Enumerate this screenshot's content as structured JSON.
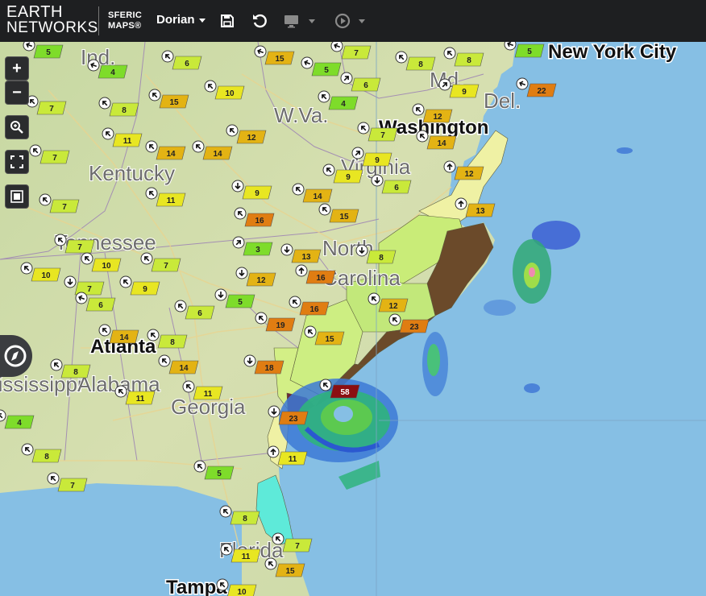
{
  "app": {
    "logo_line1": "EARTH",
    "logo_line2": "NETWORKS",
    "product_line1": "SFERIC",
    "product_line2": "MAPS®",
    "storm_selector": "Dorian"
  },
  "toolbar": {
    "icons": [
      "save-icon",
      "undo-icon",
      "monitor-icon",
      "play-icon"
    ]
  },
  "map_controls": {
    "zoom_in": "+",
    "zoom_out": "−",
    "icons": [
      "zoom-search-icon",
      "fullscreen-icon",
      "layers-icon",
      "compass-icon"
    ]
  },
  "map": {
    "labels": [
      {
        "text": "Ind.",
        "kind": "state"
      },
      {
        "text": "Md.",
        "kind": "state"
      },
      {
        "text": "Del.",
        "kind": "state"
      },
      {
        "text": "W.Va.",
        "kind": "state"
      },
      {
        "text": "Kentucky",
        "kind": "state"
      },
      {
        "text": "Virginia",
        "kind": "state"
      },
      {
        "text": "Tennessee",
        "kind": "state"
      },
      {
        "text": "North",
        "kind": "state"
      },
      {
        "text": "Carolina",
        "kind": "state"
      },
      {
        "text": "Georgia",
        "kind": "state"
      },
      {
        "text": "Mississippi",
        "kind": "state"
      },
      {
        "text": "Alabama",
        "kind": "state"
      },
      {
        "text": "Florida",
        "kind": "state"
      },
      {
        "text": "Washington",
        "kind": "city"
      },
      {
        "text": "Atlanta",
        "kind": "city"
      },
      {
        "text": "New York City",
        "kind": "city"
      },
      {
        "text": "Tampa",
        "kind": "city"
      }
    ],
    "wind_color_scale": {
      "light": "#7edc2a",
      "moderate": "#c9e93a",
      "fresh": "#e8e622",
      "strong": "#e3b314",
      "gale": "#e07d12",
      "hurricane": "#8b0e12"
    },
    "wind_stations": [
      {
        "value": "5",
        "dir": 200
      },
      {
        "value": "4",
        "dir": 200
      },
      {
        "value": "6",
        "dir": 225
      },
      {
        "value": "15",
        "dir": 200
      },
      {
        "value": "7",
        "dir": 200
      },
      {
        "value": "5",
        "dir": 200
      },
      {
        "value": "6",
        "dir": 315
      },
      {
        "value": "8",
        "dir": 225
      },
      {
        "value": "8",
        "dir": 225
      },
      {
        "value": "9",
        "dir": 315
      },
      {
        "value": "5",
        "dir": 200
      },
      {
        "value": "22",
        "dir": 200
      },
      {
        "value": "7",
        "dir": 225
      },
      {
        "value": "8",
        "dir": 225
      },
      {
        "value": "15",
        "dir": 225
      },
      {
        "value": "10",
        "dir": 225
      },
      {
        "value": "4",
        "dir": 225
      },
      {
        "value": "12",
        "dir": 225
      },
      {
        "value": "14",
        "dir": 225
      },
      {
        "value": "11",
        "dir": 225
      },
      {
        "value": "14",
        "dir": 225
      },
      {
        "value": "12",
        "dir": 225
      },
      {
        "value": "12",
        "dir": 270
      },
      {
        "value": "7",
        "dir": 225
      },
      {
        "value": "14",
        "dir": 225
      },
      {
        "value": "7",
        "dir": 225
      },
      {
        "value": "9",
        "dir": 225
      },
      {
        "value": "9",
        "dir": 315
      },
      {
        "value": "7",
        "dir": 225
      },
      {
        "value": "11",
        "dir": 225
      },
      {
        "value": "9",
        "dir": 90
      },
      {
        "value": "14",
        "dir": 225
      },
      {
        "value": "6",
        "dir": 90
      },
      {
        "value": "13",
        "dir": 270
      },
      {
        "value": "7",
        "dir": 225
      },
      {
        "value": "16",
        "dir": 225
      },
      {
        "value": "15",
        "dir": 225
      },
      {
        "value": "7",
        "dir": 225
      },
      {
        "value": "10",
        "dir": 225
      },
      {
        "value": "7",
        "dir": 90
      },
      {
        "value": "3",
        "dir": 315
      },
      {
        "value": "13",
        "dir": 90
      },
      {
        "value": "8",
        "dir": 90
      },
      {
        "value": "10",
        "dir": 225
      },
      {
        "value": "12",
        "dir": 90
      },
      {
        "value": "16",
        "dir": 270
      },
      {
        "value": "9",
        "dir": 225
      },
      {
        "value": "6",
        "dir": 200
      },
      {
        "value": "6",
        "dir": 225
      },
      {
        "value": "5",
        "dir": 90
      },
      {
        "value": "16",
        "dir": 225
      },
      {
        "value": "12",
        "dir": 225
      },
      {
        "value": "19",
        "dir": 225
      },
      {
        "value": "14",
        "dir": 225
      },
      {
        "value": "8",
        "dir": 225
      },
      {
        "value": "15",
        "dir": 225
      },
      {
        "value": "23",
        "dir": 225
      },
      {
        "value": "18",
        "dir": 90
      },
      {
        "value": "14",
        "dir": 225
      },
      {
        "value": "8",
        "dir": 225
      },
      {
        "value": "11",
        "dir": 225
      },
      {
        "value": "11",
        "dir": 225
      },
      {
        "value": "58",
        "dir": 225
      },
      {
        "value": "23",
        "dir": 90
      },
      {
        "value": "4",
        "dir": 225
      },
      {
        "value": "8",
        "dir": 225
      },
      {
        "value": "11",
        "dir": 270
      },
      {
        "value": "5",
        "dir": 225
      },
      {
        "value": "7",
        "dir": 225
      },
      {
        "value": "8",
        "dir": 225
      },
      {
        "value": "7",
        "dir": 225
      },
      {
        "value": "11",
        "dir": 225
      },
      {
        "value": "15",
        "dir": 225
      },
      {
        "value": "10",
        "dir": 225
      }
    ]
  }
}
